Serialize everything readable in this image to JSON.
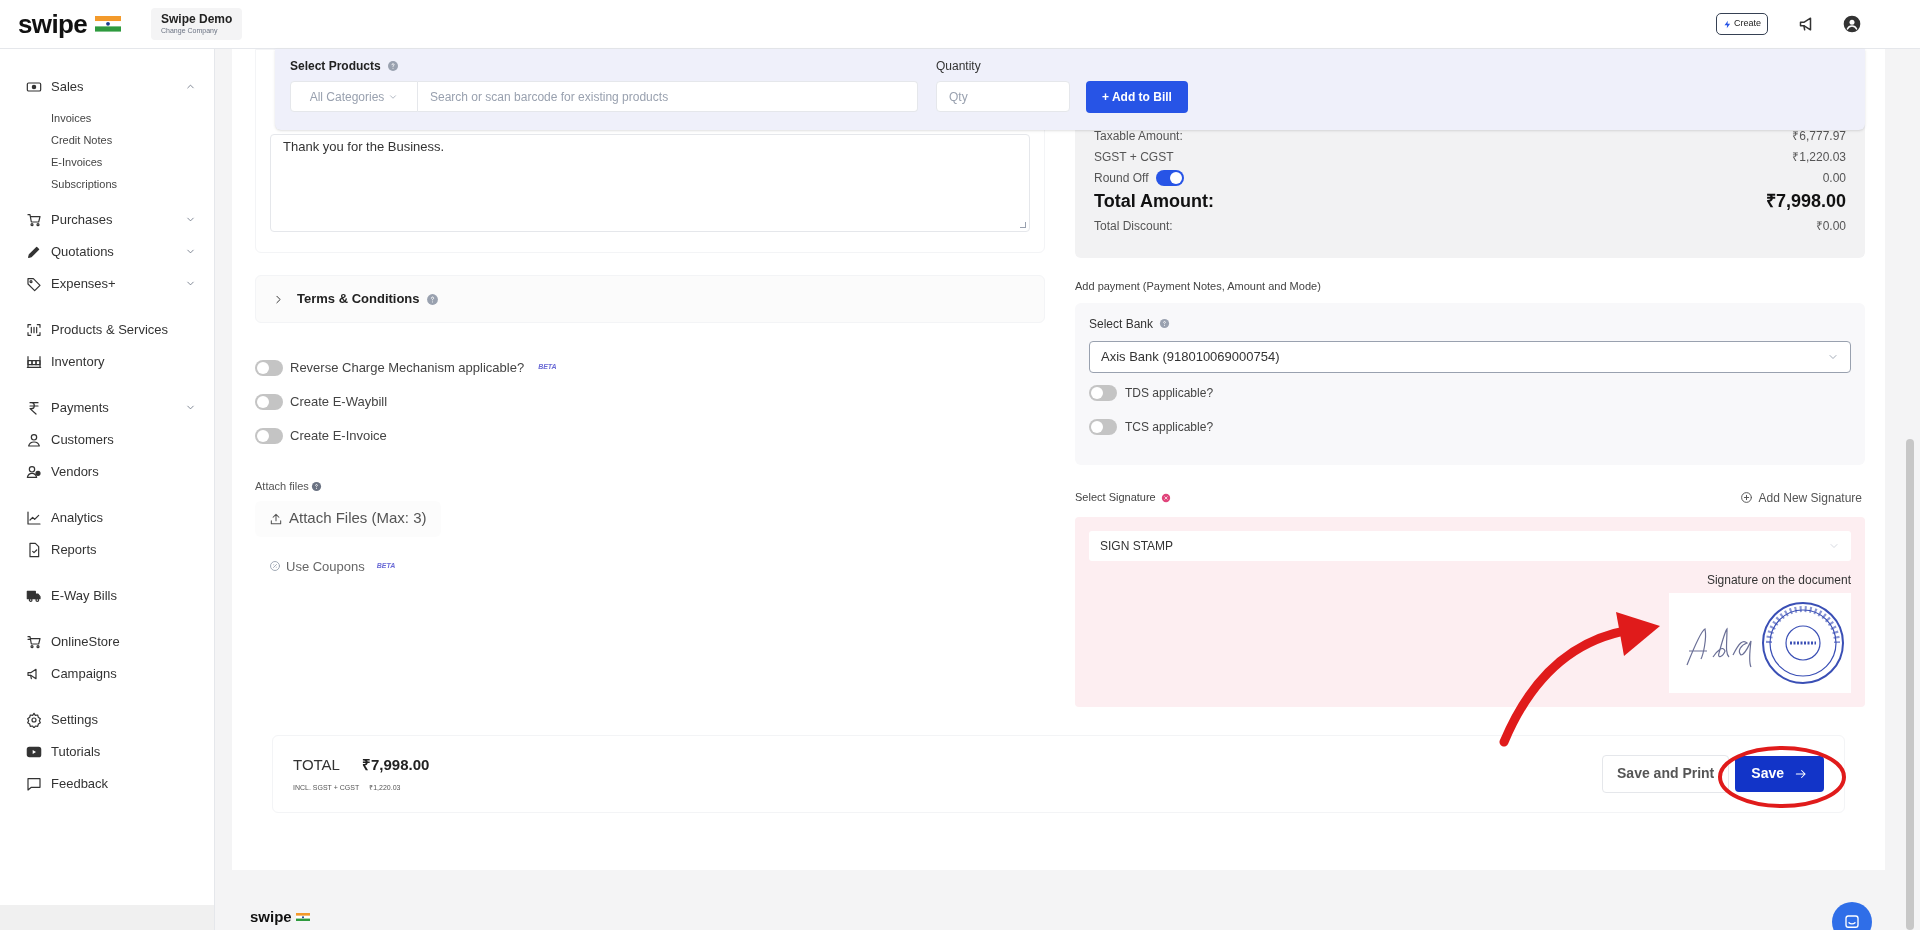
{
  "header": {
    "logo": "swipe",
    "company": "Swipe Demo",
    "company_action": "Change Company",
    "create_button": "Create"
  },
  "sidebar": {
    "groups": [
      [
        {
          "label": "Sales",
          "expanded": true,
          "children": [
            "Invoices",
            "Credit Notes",
            "E-Invoices",
            "Subscriptions"
          ]
        },
        {
          "label": "Purchases",
          "expanded": false
        },
        {
          "label": "Quotations",
          "expanded": false
        },
        {
          "label": "Expenses+",
          "expanded": false
        }
      ],
      [
        {
          "label": "Products & Services"
        },
        {
          "label": "Inventory"
        }
      ],
      [
        {
          "label": "Payments",
          "expanded": false
        },
        {
          "label": "Customers"
        },
        {
          "label": "Vendors"
        }
      ],
      [
        {
          "label": "Analytics"
        },
        {
          "label": "Reports"
        }
      ],
      [
        {
          "label": "E-Way Bills"
        }
      ],
      [
        {
          "label": "OnlineStore"
        },
        {
          "label": "Campaigns"
        }
      ],
      [
        {
          "label": "Settings"
        },
        {
          "label": "Tutorials"
        },
        {
          "label": "Feedback"
        }
      ]
    ]
  },
  "product_bar": {
    "label": "Select Products",
    "category": "All Categories",
    "search": {
      "placeholder": "Search or scan barcode for existing products"
    },
    "quantity_label": "Quantity",
    "quantity": {
      "placeholder": "Qty"
    },
    "add_button": "+ Add to Bill"
  },
  "notes": {
    "value": "Thank you for the Business."
  },
  "terms": {
    "label": "Terms & Conditions",
    "expanded": false
  },
  "options": [
    {
      "label": "Reverse Charge Mechanism applicable?",
      "on": false,
      "badge": "BETA"
    },
    {
      "label": "Create E-Waybill",
      "on": false
    },
    {
      "label": "Create E-Invoice",
      "on": false
    }
  ],
  "attach": {
    "label": "Attach files",
    "button": "Attach Files (Max: 3)"
  },
  "coupons": {
    "label": "Use Coupons",
    "badge": "BETA"
  },
  "summary": {
    "rows": [
      {
        "kind": "line",
        "label": "Taxable Amount:",
        "value": "₹6,777.97"
      },
      {
        "kind": "line",
        "label": "SGST + CGST",
        "value": "₹1,220.03"
      },
      {
        "kind": "toggle",
        "label": "Round Off",
        "on": true,
        "value": "0.00"
      },
      {
        "kind": "total",
        "label": "Total Amount:",
        "value": "₹7,998.00"
      },
      {
        "kind": "line",
        "label": "Total Discount:",
        "value": "₹0.00"
      }
    ]
  },
  "payment": {
    "heading": "Add payment (Payment Notes, Amount and Mode)",
    "bank_label": "Select Bank",
    "bank": "Axis Bank (918010069000754)",
    "options": [
      {
        "label": "TDS applicable?",
        "on": false
      },
      {
        "label": "TCS applicable?",
        "on": false
      }
    ]
  },
  "signature": {
    "label": "Select Signature",
    "add_link": "Add New Signature",
    "selected": "SIGN STAMP",
    "preview_label": "Signature on the document"
  },
  "total_bar": {
    "label": "TOTAL",
    "amount": "₹7,998.00",
    "tax_label": "INCL. SGST + CGST",
    "tax_amount": "₹1,220.03",
    "buttons": [
      {
        "kind": "secondary",
        "label": "Save and Print"
      },
      {
        "kind": "primary",
        "label": "Save"
      }
    ]
  },
  "footer": {
    "logo": "swipe"
  }
}
